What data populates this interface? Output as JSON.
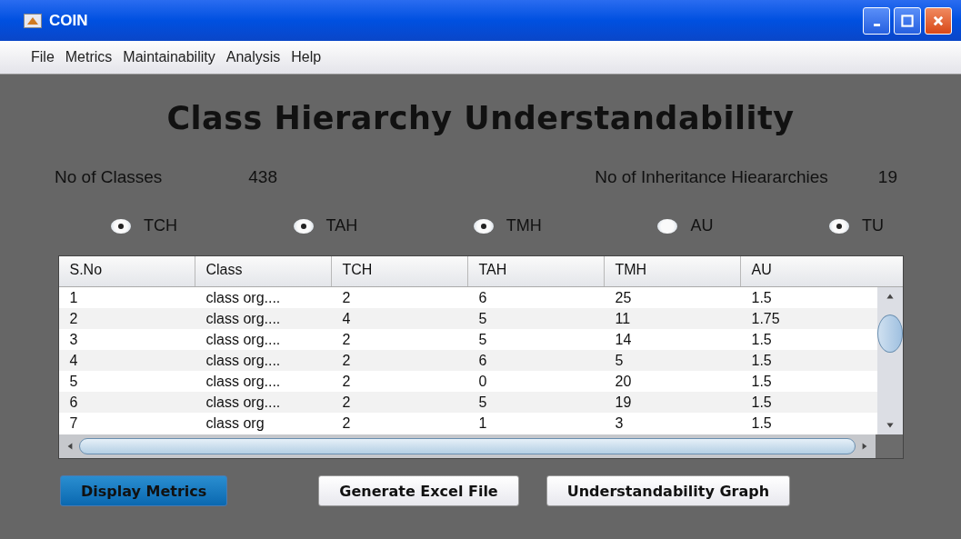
{
  "window": {
    "title": "COIN"
  },
  "menu": [
    "File",
    "Metrics",
    "Maintainability",
    "Analysis",
    "Help"
  ],
  "heading": "Class Hierarchy Understandability",
  "stats": [
    {
      "label": "No of Classes",
      "value": "438"
    },
    {
      "label": "No of Inheritance Hieararchies",
      "value": "19"
    }
  ],
  "options": [
    {
      "label": "TCH",
      "selected": true
    },
    {
      "label": "TAH",
      "selected": true
    },
    {
      "label": "TMH",
      "selected": true
    },
    {
      "label": "AU",
      "selected": false
    },
    {
      "label": "TU",
      "selected": true
    }
  ],
  "table": {
    "columns": [
      "S.No",
      "Class",
      "TCH",
      "TAH",
      "TMH",
      "AU"
    ],
    "rows": [
      [
        "1",
        "class org....",
        "2",
        "6",
        "25",
        "1.5"
      ],
      [
        "2",
        "class org....",
        "4",
        "5",
        "11",
        "1.75"
      ],
      [
        "3",
        "class org....",
        "2",
        "5",
        "14",
        "1.5"
      ],
      [
        "4",
        "class org....",
        "2",
        "6",
        "5",
        "1.5"
      ],
      [
        "5",
        "class org....",
        "2",
        "0",
        "20",
        "1.5"
      ],
      [
        "6",
        "class org....",
        "2",
        "5",
        "19",
        "1.5"
      ],
      [
        "7",
        "class org",
        "2",
        "1",
        "3",
        "1.5"
      ]
    ]
  },
  "buttons": [
    {
      "label": "Display Metrics",
      "selected": true
    },
    {
      "label": "Generate Excel File",
      "selected": false
    },
    {
      "label": "Understandability Graph",
      "selected": false
    }
  ]
}
